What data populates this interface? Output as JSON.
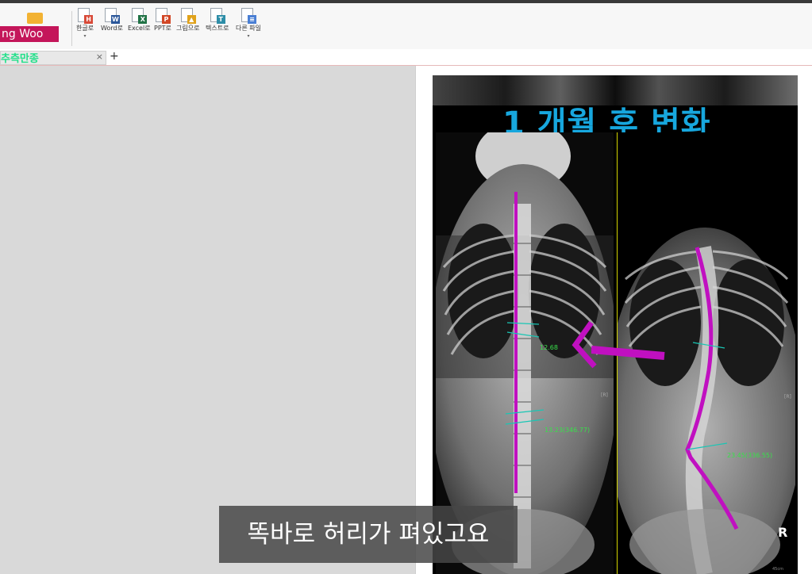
{
  "user": {
    "name": "ng Woo"
  },
  "ribbon": {
    "items": [
      {
        "label": "한글로",
        "badge": "H",
        "color": "#d84a38"
      },
      {
        "label": "Word로",
        "badge": "W",
        "color": "#2b579a"
      },
      {
        "label": "Excel로",
        "badge": "X",
        "color": "#217346"
      },
      {
        "label": "PPT로",
        "badge": "P",
        "color": "#d24726"
      },
      {
        "label": "그림으로",
        "badge": "▲",
        "color": "#e0a21b"
      },
      {
        "label": "텍스트로",
        "badge": "T",
        "color": "#2e8ea8"
      },
      {
        "label": "다른 파일",
        "badge": "≡",
        "color": "#4a7fd4"
      }
    ]
  },
  "tabs": {
    "active_label": "추측만종"
  },
  "xray": {
    "title": "1 개월 후 변화",
    "left_measure_1": "12.68",
    "left_measure_2": "13.23(346.77)",
    "right_measure": "23.45(336.55)",
    "side_marker": "R",
    "scale_label": "45cm"
  },
  "subtitle": "똑바로 허리가 펴있고요"
}
